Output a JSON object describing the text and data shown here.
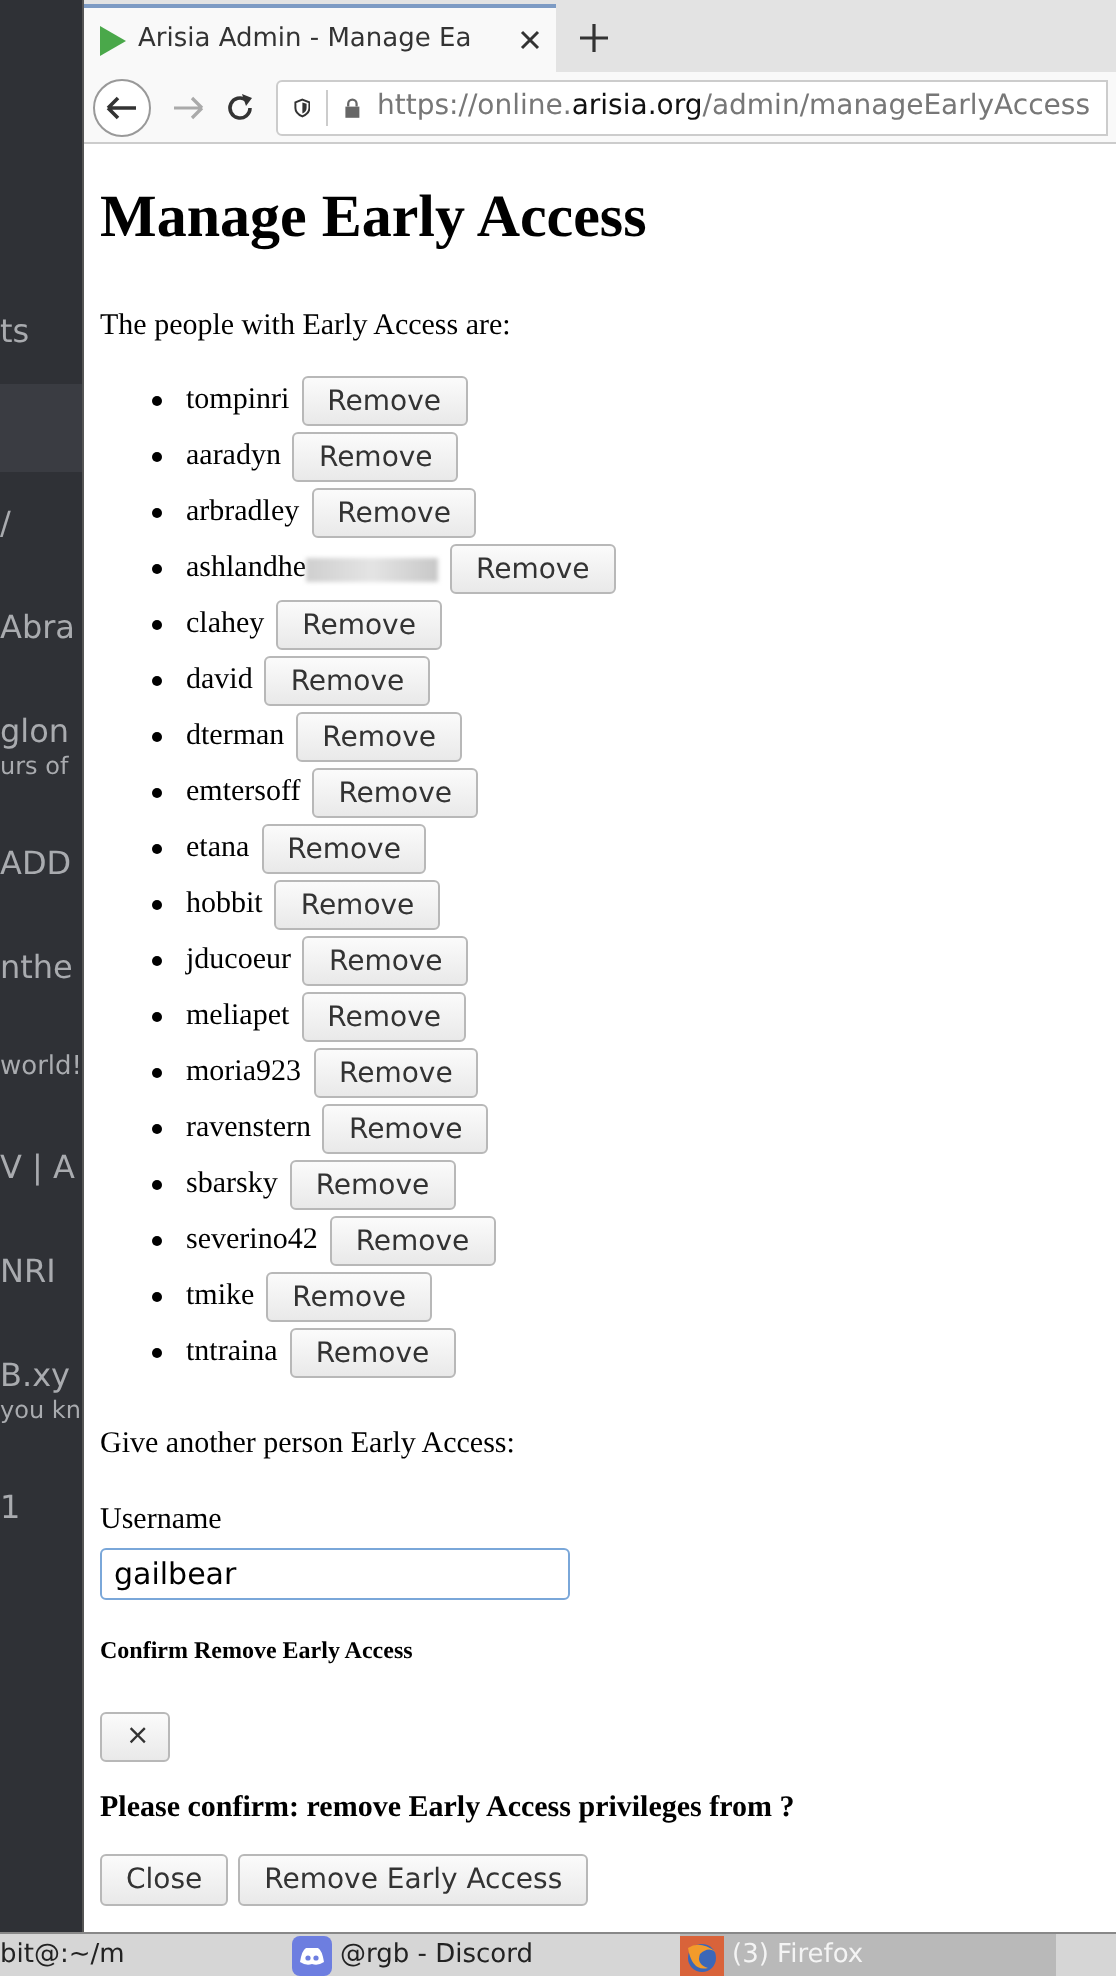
{
  "side_panel": {
    "fragments": [
      {
        "text": "ts",
        "selected": false
      },
      {
        "selected": true
      },
      {
        "text": "/",
        "selected": false
      },
      {
        "text": "Abra",
        "selected": false
      },
      {
        "text": "glon",
        "selected": false
      },
      {
        "text": "urs of",
        "selected": false
      },
      {
        "text": "ADD",
        "selected": false
      },
      {
        "text": "nthe",
        "selected": false
      },
      {
        "text": "world!",
        "selected": false
      },
      {
        "text": "V | A",
        "selected": false
      },
      {
        "text": "NRI",
        "selected": false
      },
      {
        "text": "B.xy",
        "selected": false
      },
      {
        "text": "you kn",
        "selected": false
      },
      {
        "text": "1",
        "selected": false
      }
    ]
  },
  "browser": {
    "tab": {
      "title": "Arisia Admin - Manage Ea"
    },
    "address": {
      "prefix": "https://online.",
      "domain": "arisia.org",
      "path": "/admin/manageEarlyAccess"
    }
  },
  "page": {
    "title": "Manage Early Access",
    "intro": "The people with Early Access are:",
    "people": [
      {
        "name": "tompinri",
        "redacted": false,
        "button": "Remove"
      },
      {
        "name": "aaradyn",
        "redacted": false,
        "button": "Remove"
      },
      {
        "name": "arbradley",
        "redacted": false,
        "button": "Remove"
      },
      {
        "name": "ashlandhe",
        "redacted": true,
        "button": "Remove"
      },
      {
        "name": "clahey",
        "redacted": false,
        "button": "Remove"
      },
      {
        "name": "david",
        "redacted": false,
        "button": "Remove"
      },
      {
        "name": "dterman",
        "redacted": false,
        "button": "Remove"
      },
      {
        "name": "emtersoff",
        "redacted": false,
        "button": "Remove"
      },
      {
        "name": "etana",
        "redacted": false,
        "button": "Remove"
      },
      {
        "name": "hobbit",
        "redacted": false,
        "button": "Remove"
      },
      {
        "name": "jducoeur",
        "redacted": false,
        "button": "Remove"
      },
      {
        "name": "meliapet",
        "redacted": false,
        "button": "Remove"
      },
      {
        "name": "moria923",
        "redacted": false,
        "button": "Remove"
      },
      {
        "name": "ravenstern",
        "redacted": false,
        "button": "Remove"
      },
      {
        "name": "sbarsky",
        "redacted": false,
        "button": "Remove"
      },
      {
        "name": "severino42",
        "redacted": false,
        "button": "Remove"
      },
      {
        "name": "tmike",
        "redacted": false,
        "button": "Remove"
      },
      {
        "name": "tntraina",
        "redacted": false,
        "button": "Remove"
      }
    ],
    "add_heading": "Give another person Early Access:",
    "username_label": "Username",
    "username_value": "gailbear",
    "dialog": {
      "title": "Confirm Remove Early Access",
      "close_x": "×",
      "message": "Please confirm: remove Early Access privileges from ?",
      "buttons": [
        "Close",
        "Remove Early Access"
      ]
    }
  },
  "taskbar": {
    "items": [
      {
        "kind": "terminal",
        "label": "bit@:~/m",
        "selected": false
      },
      {
        "kind": "discord",
        "label": "@rgb - Discord",
        "selected": false
      },
      {
        "kind": "firefox",
        "label": "(3) Firefox",
        "selected": true
      }
    ]
  }
}
